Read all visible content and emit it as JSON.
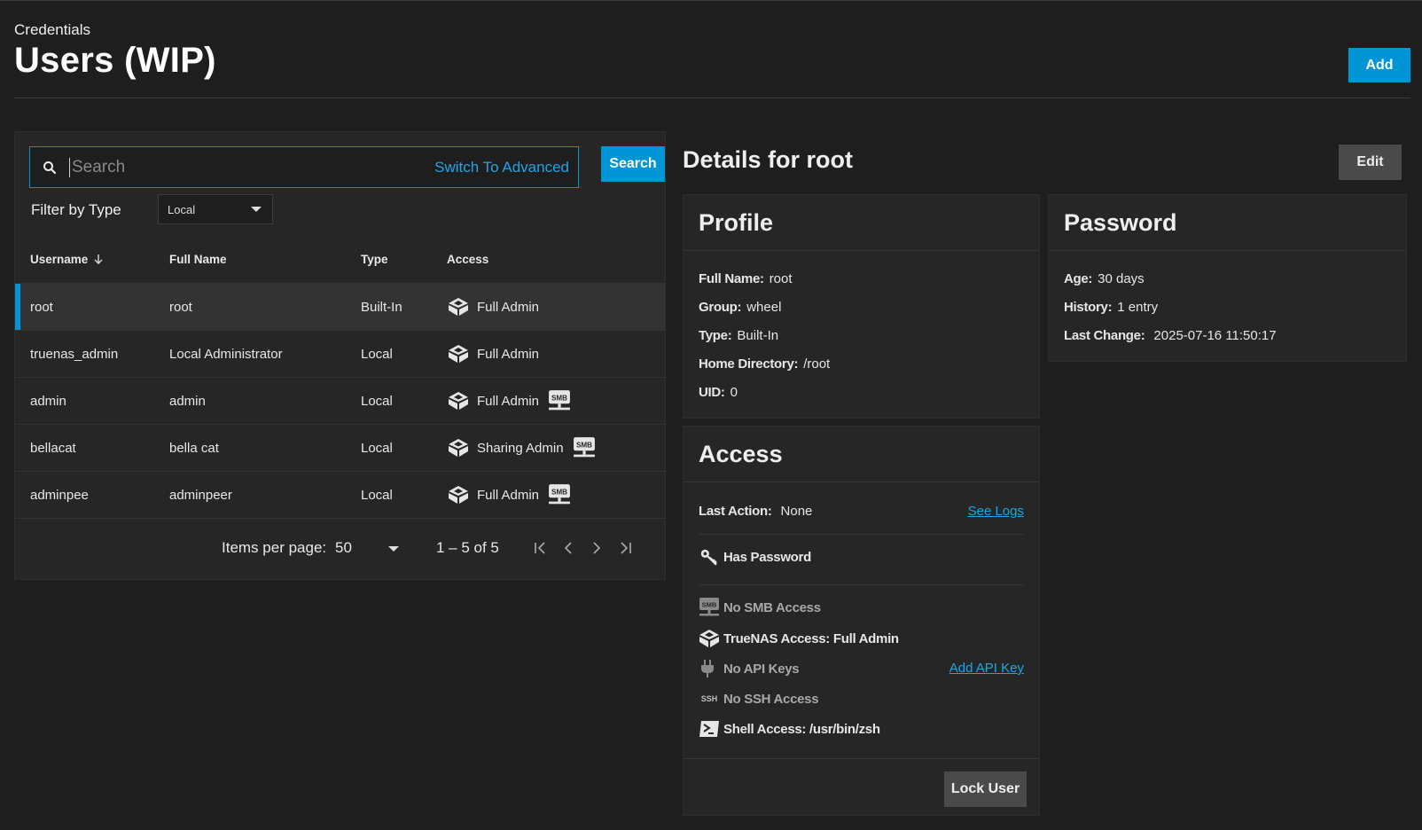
{
  "header": {
    "breadcrumb": "Credentials",
    "title": "Users (WIP)",
    "add_label": "Add"
  },
  "search": {
    "placeholder": "Search",
    "switch_label": "Switch To Advanced",
    "button_label": "Search",
    "filter_label": "Filter by Type",
    "filter_value": "Local"
  },
  "table": {
    "columns": [
      "Username",
      "Full Name",
      "Type",
      "Access"
    ],
    "rows": [
      {
        "username": "root",
        "full_name": "root",
        "type": "Built-In",
        "access": "Full Admin",
        "smb": false
      },
      {
        "username": "truenas_admin",
        "full_name": "Local Administrator",
        "type": "Local",
        "access": "Full Admin",
        "smb": false
      },
      {
        "username": "admin",
        "full_name": "admin",
        "type": "Local",
        "access": "Full Admin",
        "smb": true
      },
      {
        "username": "bellacat",
        "full_name": "bella cat",
        "type": "Local",
        "access": "Sharing Admin",
        "smb": true
      },
      {
        "username": "adminpee",
        "full_name": "adminpeer",
        "type": "Local",
        "access": "Full Admin",
        "smb": true
      }
    ],
    "selected_row": 0
  },
  "paginator": {
    "items_label": "Items per page:",
    "page_size": "50",
    "range": "1 – 5 of 5"
  },
  "details": {
    "title": "Details for root",
    "edit_label": "Edit",
    "profile": {
      "title": "Profile",
      "full_name_k": "Full Name:",
      "full_name_v": "root",
      "group_k": "Group:",
      "group_v": "wheel",
      "type_k": "Type:",
      "type_v": "Built-In",
      "home_k": "Home Directory:",
      "home_v": "/root",
      "uid_k": "UID:",
      "uid_v": "0"
    },
    "password": {
      "title": "Password",
      "age_k": "Age:",
      "age_v": "30 days",
      "history_k": "History:",
      "history_v": "1 entry",
      "last_change_k": "Last Change:",
      "last_change_v": "2025-07-16 11:50:17"
    },
    "access": {
      "title": "Access",
      "last_action_k": "Last Action:",
      "last_action_v": "None",
      "see_logs": "See Logs",
      "has_password": "Has Password",
      "smb": "No SMB Access",
      "truenas": "TrueNAS Access: Full Admin",
      "api_keys": "No API Keys",
      "add_api_key": "Add API Key",
      "ssh": "No SSH Access",
      "shell": "Shell Access: /usr/bin/zsh",
      "lock_label": "Lock User"
    }
  },
  "colors": {
    "accent": "#0095d5",
    "background": "#1e1e1e",
    "panel": "#262626"
  }
}
